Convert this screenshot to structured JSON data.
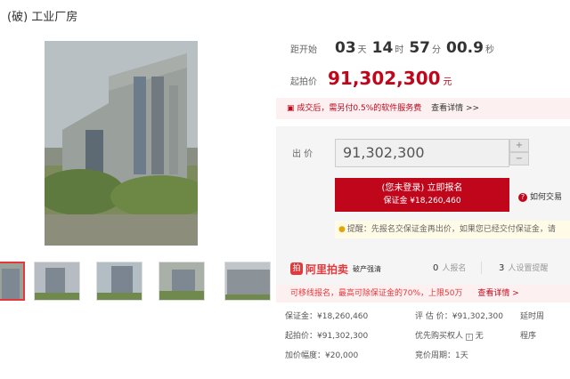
{
  "title": "(破) 工业厂房",
  "countdown": {
    "label": "距开始",
    "days": "03",
    "days_unit": "天",
    "hours": "14",
    "hours_unit": "时",
    "minutes": "57",
    "minutes_unit": "分",
    "seconds": "00.9",
    "seconds_unit": "秒"
  },
  "start_price": {
    "label": "起拍价",
    "value": "91,302,300",
    "unit": "元"
  },
  "notice": {
    "text": "成交后，需另付0.5%的软件服务费",
    "link": "查看详情 >>"
  },
  "bid": {
    "label": "出 价",
    "value": "91,302,300",
    "plus": "+",
    "minus": "−",
    "register_line1": "(您未登录) 立即报名",
    "register_line2": "保证金 ¥18,260,460",
    "help": "如何交易"
  },
  "reminder": "提醒：先报名交保证金再出价，如果您已经交付保证金，请",
  "platform": {
    "logo_mark": "拍",
    "logo": "阿里拍卖",
    "sub": "破产强清",
    "registered_count": "0",
    "registered_label": "人报名",
    "reminder_count": "3",
    "reminder_label": "人设置提醒"
  },
  "promo": {
    "text": "可移线报名，最高可除保证金的70%，上限50万",
    "link": "查看详情 >"
  },
  "details": {
    "deposit": "保证金：¥18,260,460",
    "appraisal": "评 估 价：¥91,302,300",
    "extension": "延时周",
    "start": "起拍价：¥91,302,300",
    "priority": "优先购买权人",
    "priority_value": "无",
    "procedure": "程序",
    "increment": "加价幅度：¥20,000",
    "period": "竞价周期：1天"
  }
}
